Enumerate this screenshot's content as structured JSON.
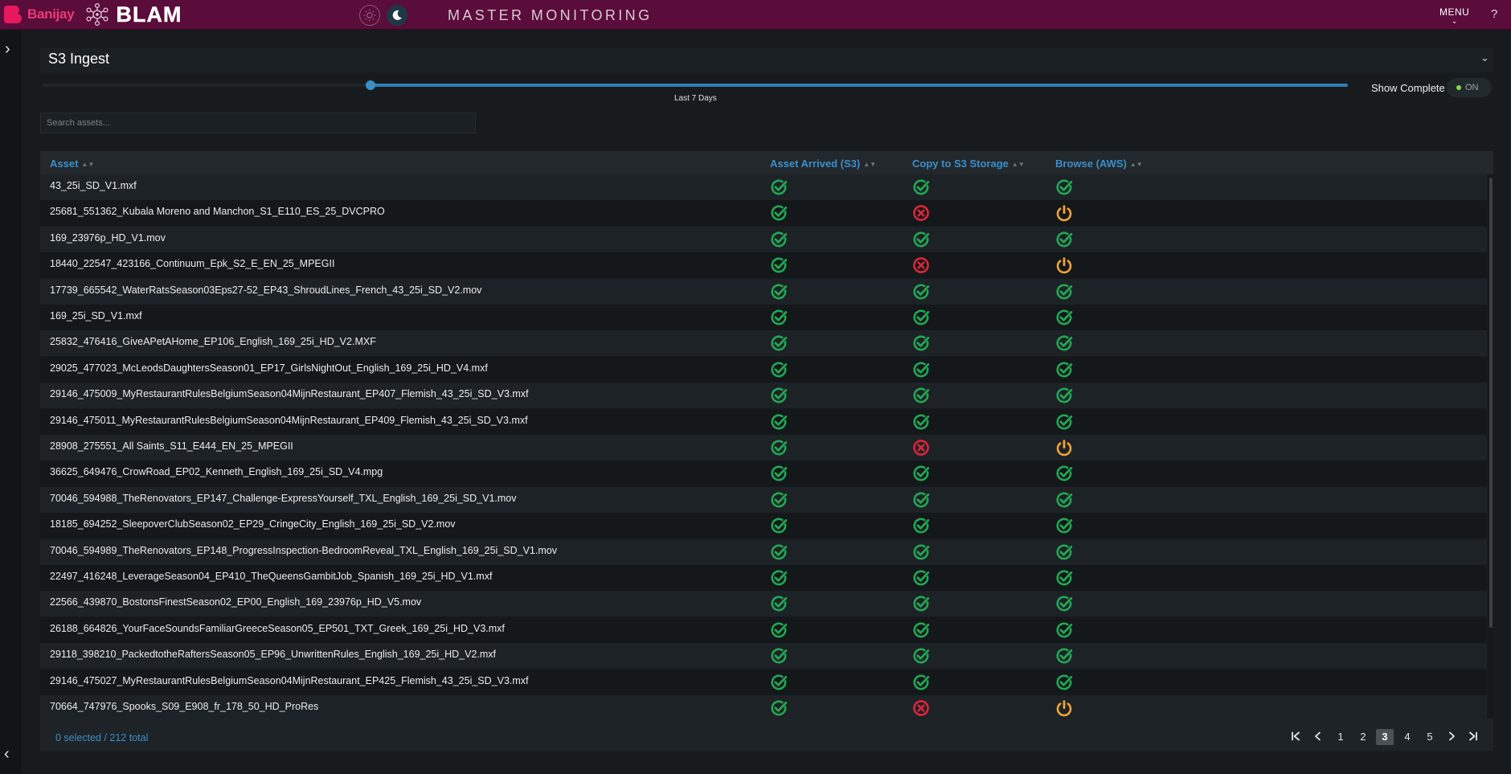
{
  "header": {
    "banijay_label": "Banijay",
    "blam_label": "BLAM",
    "title": "MASTER MONITORING",
    "menu_label": "MENU",
    "help_label": "?",
    "colors": {
      "bar": "#5a0c3a",
      "banijay": "#e8185f"
    }
  },
  "panel": {
    "title": "S3 Ingest",
    "range_label": "Last 7 Days",
    "show_complete_label": "Show Complete",
    "toggle_label": "ON",
    "search_placeholder": "Search assets..."
  },
  "table": {
    "columns": {
      "asset": "Asset",
      "arrived": "Asset Arrived (S3)",
      "copy": "Copy to S3 Storage",
      "browse": "Browse (AWS)"
    },
    "status_icons": {
      "ok": "check-circle-icon",
      "error": "x-circle-icon",
      "pending": "power-icon"
    },
    "status_colors": {
      "ok": "#22a753",
      "error": "#d9263b",
      "pending": "#f0a23a"
    },
    "rows": [
      {
        "name": "43_25i_SD_V1.mxf",
        "arrived": "ok",
        "copy": "ok",
        "browse": "ok"
      },
      {
        "name": "25681_551362_Kubala Moreno and Manchon_S1_E110_ES_25_DVCPRO",
        "arrived": "ok",
        "copy": "error",
        "browse": "pending"
      },
      {
        "name": "169_23976p_HD_V1.mov",
        "arrived": "ok",
        "copy": "ok",
        "browse": "ok"
      },
      {
        "name": "18440_22547_423166_Continuum_Epk_S2_E_EN_25_MPEGII",
        "arrived": "ok",
        "copy": "error",
        "browse": "pending"
      },
      {
        "name": "17739_665542_WaterRatsSeason03Eps27-52_EP43_ShroudLines_French_43_25i_SD_V2.mov",
        "arrived": "ok",
        "copy": "ok",
        "browse": "ok"
      },
      {
        "name": "169_25i_SD_V1.mxf",
        "arrived": "ok",
        "copy": "ok",
        "browse": "ok"
      },
      {
        "name": "25832_476416_GiveAPetAHome_EP106_English_169_25i_HD_V2.MXF",
        "arrived": "ok",
        "copy": "ok",
        "browse": "ok"
      },
      {
        "name": "29025_477023_McLeodsDaughtersSeason01_EP17_GirlsNightOut_English_169_25i_HD_V4.mxf",
        "arrived": "ok",
        "copy": "ok",
        "browse": "ok"
      },
      {
        "name": "29146_475009_MyRestaurantRulesBelgiumSeason04MijnRestaurant_EP407_Flemish_43_25i_SD_V3.mxf",
        "arrived": "ok",
        "copy": "ok",
        "browse": "ok"
      },
      {
        "name": "29146_475011_MyRestaurantRulesBelgiumSeason04MijnRestaurant_EP409_Flemish_43_25i_SD_V3.mxf",
        "arrived": "ok",
        "copy": "ok",
        "browse": "ok"
      },
      {
        "name": "28908_275551_All Saints_S11_E444_EN_25_MPEGII",
        "arrived": "ok",
        "copy": "error",
        "browse": "pending"
      },
      {
        "name": "36625_649476_CrowRoad_EP02_Kenneth_English_169_25i_SD_V4.mpg",
        "arrived": "ok",
        "copy": "ok",
        "browse": "ok"
      },
      {
        "name": "70046_594988_TheRenovators_EP147_Challenge-ExpressYourself_TXL_English_169_25i_SD_V1.mov",
        "arrived": "ok",
        "copy": "ok",
        "browse": "ok"
      },
      {
        "name": "18185_694252_SleepoverClubSeason02_EP29_CringeCity_English_169_25i_SD_V2.mov",
        "arrived": "ok",
        "copy": "ok",
        "browse": "ok"
      },
      {
        "name": "70046_594989_TheRenovators_EP148_ProgressInspection-BedroomReveal_TXL_English_169_25i_SD_V1.mov",
        "arrived": "ok",
        "copy": "ok",
        "browse": "ok"
      },
      {
        "name": "22497_416248_LeverageSeason04_EP410_TheQueensGambitJob_Spanish_169_25i_HD_V1.mxf",
        "arrived": "ok",
        "copy": "ok",
        "browse": "ok"
      },
      {
        "name": "22566_439870_BostonsFinestSeason02_EP00_English_169_23976p_HD_V5.mov",
        "arrived": "ok",
        "copy": "ok",
        "browse": "ok"
      },
      {
        "name": "26188_664826_YourFaceSoundsFamiliarGreeceSeason05_EP501_TXT_Greek_169_25i_HD_V3.mxf",
        "arrived": "ok",
        "copy": "ok",
        "browse": "ok"
      },
      {
        "name": "29118_398210_PackedtotheRaftersSeason05_EP96_UnwrittenRules_English_169_25i_HD_V2.mxf",
        "arrived": "ok",
        "copy": "ok",
        "browse": "ok"
      },
      {
        "name": "29146_475027_MyRestaurantRulesBelgiumSeason04MijnRestaurant_EP425_Flemish_43_25i_SD_V3.mxf",
        "arrived": "ok",
        "copy": "ok",
        "browse": "ok"
      },
      {
        "name": "70664_747976_Spooks_S09_E908_fr_178_50_HD_ProRes",
        "arrived": "ok",
        "copy": "error",
        "browse": "pending"
      }
    ]
  },
  "footer": {
    "selection_text": "0 selected / 212 total",
    "first_icon": "first-page-icon",
    "prev_icon": "prev-page-icon",
    "next_icon": "next-page-icon",
    "last_icon": "last-page-icon",
    "pages": [
      "1",
      "2",
      "3",
      "4",
      "5"
    ],
    "current_page": "3"
  }
}
